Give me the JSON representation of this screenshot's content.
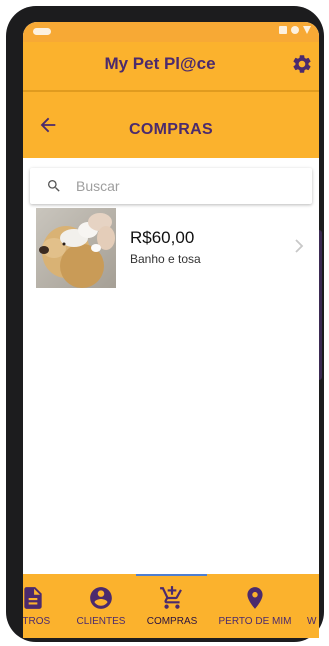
{
  "app": {
    "title": "My Pet Pl@ce"
  },
  "page": {
    "title": "COMPRAS"
  },
  "search": {
    "placeholder": "Buscar",
    "value": ""
  },
  "items": [
    {
      "price": "R$60,00",
      "description": "Banho e tosa",
      "image": "dog-bath-photo"
    }
  ],
  "bottom_nav": [
    {
      "label": "STROS",
      "icon": "document-icon"
    },
    {
      "label": "CLIENTES",
      "icon": "account-circle-icon"
    },
    {
      "label": "COMPRAS",
      "icon": "cart-icon",
      "active": true
    },
    {
      "label": "PERTO DE MIM",
      "icon": "location-pin-icon"
    },
    {
      "label": "W",
      "icon": ""
    }
  ],
  "colors": {
    "primary": "#fbb22d",
    "accent": "#4b2a6d",
    "status_bar": "#f7a935",
    "nav_indicator": "#4f7fd0"
  }
}
